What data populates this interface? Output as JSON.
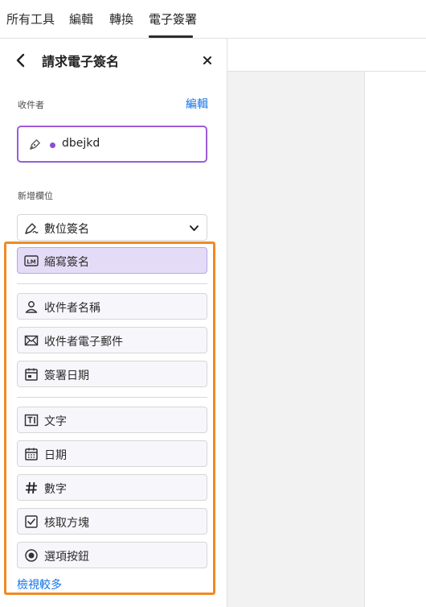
{
  "topbar": {
    "tabs": [
      {
        "label": "所有工具"
      },
      {
        "label": "編輯"
      },
      {
        "label": "轉換"
      },
      {
        "label": "電子簽署"
      }
    ]
  },
  "panel": {
    "title": "請求電子簽名",
    "recipients_label": "收件者",
    "edit_label": "編輯",
    "recipient": {
      "name": "dbejkd",
      "color": "#8a4fd1"
    },
    "add_fields_label": "新增欄位",
    "dropdown_label": "數位簽名",
    "fields": [
      {
        "label": "縮寫簽名",
        "icon": "initials-icon"
      },
      {
        "label": "收件者名稱",
        "icon": "person-icon"
      },
      {
        "label": "收件者電子郵件",
        "icon": "mail-icon"
      },
      {
        "label": "簽署日期",
        "icon": "calendar-signed-icon"
      },
      {
        "label": "文字",
        "icon": "text-field-icon"
      },
      {
        "label": "日期",
        "icon": "calendar-icon"
      },
      {
        "label": "數字",
        "icon": "hash-icon"
      },
      {
        "label": "核取方塊",
        "icon": "checkbox-icon"
      },
      {
        "label": "選項按鈕",
        "icon": "radio-icon"
      }
    ],
    "more_label": "檢視較多"
  },
  "colors": {
    "accent": "#1473e6",
    "recipient_border": "#9b5bd9",
    "highlight": "#f08a24",
    "selected_field": "#e4dcf7"
  }
}
